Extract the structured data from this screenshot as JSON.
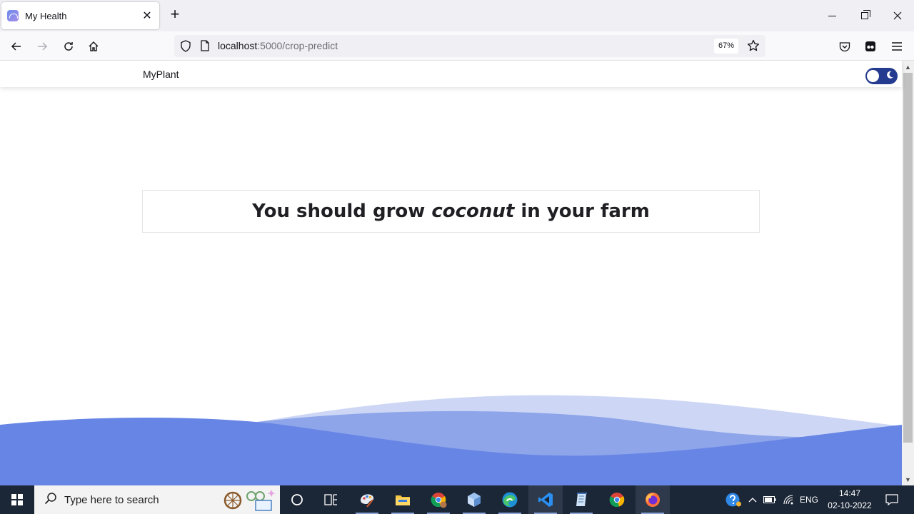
{
  "browser": {
    "tab_title": "My Health",
    "url_host": "localhost",
    "url_path": ":5000/crop-predict",
    "zoom": "67%"
  },
  "site": {
    "brand": "MyPlant",
    "result_prefix": "You should grow ",
    "crop": "coconut",
    "result_suffix": " in your farm",
    "theme_toggle_on": true
  },
  "colors": {
    "wave_front": "#6785e4",
    "wave_middle": "#8ea5ea",
    "wave_back": "#cdd7f5",
    "toggle": "#243b8f"
  },
  "taskbar": {
    "search_placeholder": "Type here to search",
    "language": "ENG",
    "time": "14:47",
    "date": "02-10-2022",
    "pinned_apps": [
      "cortana-icon",
      "task-view-icon",
      "paint-icon",
      "file-explorer-icon",
      "chrome-profile-icon",
      "3d-viewer-icon",
      "edge-icon",
      "vscode-icon",
      "notepad-icon",
      "chrome-icon",
      "firefox-icon"
    ]
  }
}
